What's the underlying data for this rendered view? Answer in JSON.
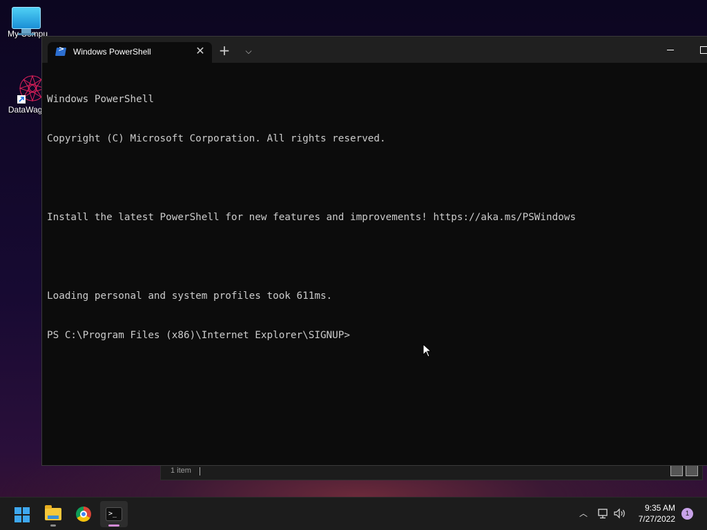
{
  "desktop": {
    "icons": [
      {
        "label": "My Compu",
        "icon": "computer-icon"
      },
      {
        "label": "DataWago",
        "icon": "datawagon-icon"
      }
    ]
  },
  "explorer_behind": {
    "status": "1 item"
  },
  "terminal": {
    "tab_title": "Windows PowerShell",
    "tab_icon": "powershell-icon",
    "lines": [
      "Windows PowerShell",
      "Copyright (C) Microsoft Corporation. All rights reserved.",
      "",
      "Install the latest PowerShell for new features and improvements! https://aka.ms/PSWindows",
      "",
      "Loading personal and system profiles took 611ms.",
      "PS C:\\Program Files (x86)\\Internet Explorer\\SIGNUP>"
    ]
  },
  "taskbar": {
    "apps": [
      {
        "name": "Start",
        "icon": "windows-logo-icon"
      },
      {
        "name": "File Explorer",
        "icon": "folder-icon"
      },
      {
        "name": "Google Chrome",
        "icon": "chrome-icon"
      },
      {
        "name": "Windows Terminal",
        "icon": "terminal-icon"
      }
    ],
    "clock": {
      "time": "9:35 AM",
      "date": "7/27/2022"
    },
    "notification_count": "1"
  },
  "colors": {
    "console_bg": "#0c0c0c",
    "console_fg": "#cccccc",
    "tab_bar": "#202020",
    "taskbar": "#1c1c1c",
    "accent": "#3ea8f0"
  }
}
